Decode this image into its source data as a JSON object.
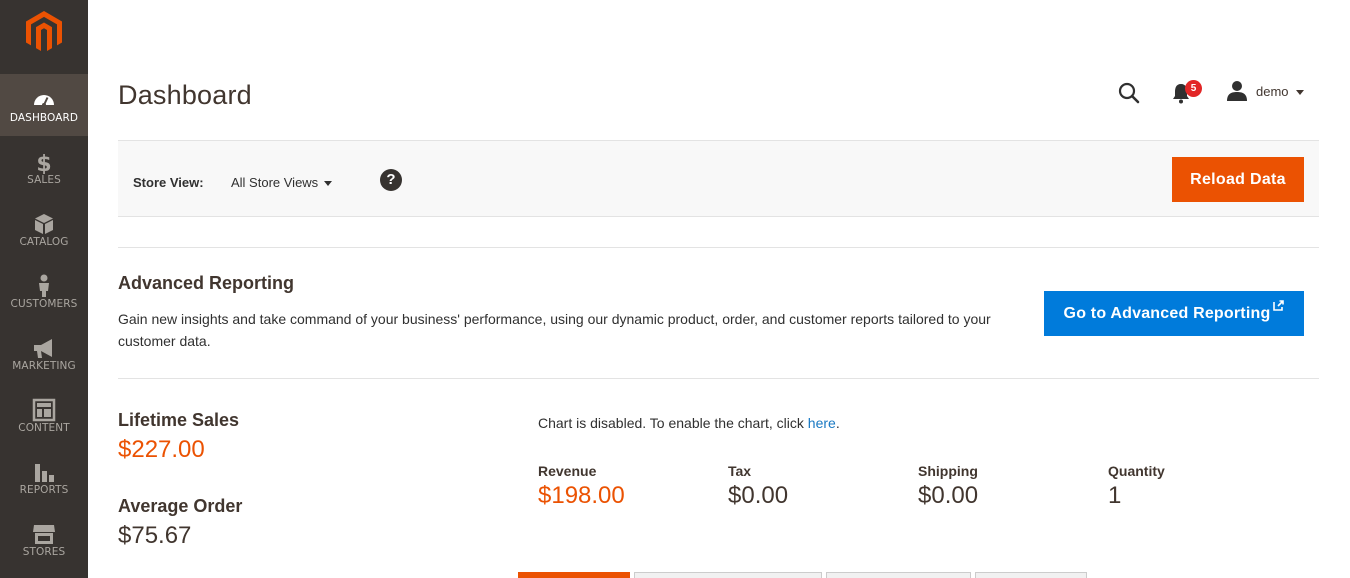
{
  "sidebar": {
    "items": [
      {
        "label": "DASHBOARD",
        "icon": "dashboard-icon"
      },
      {
        "label": "SALES",
        "icon": "dollar-icon"
      },
      {
        "label": "CATALOG",
        "icon": "box-icon"
      },
      {
        "label": "CUSTOMERS",
        "icon": "person-icon"
      },
      {
        "label": "MARKETING",
        "icon": "megaphone-icon"
      },
      {
        "label": "CONTENT",
        "icon": "layout-icon"
      },
      {
        "label": "REPORTS",
        "icon": "bar-chart-icon"
      },
      {
        "label": "STORES",
        "icon": "storefront-icon"
      }
    ]
  },
  "header": {
    "title": "Dashboard",
    "notification_count": "5",
    "user_name": "demo"
  },
  "store_bar": {
    "label": "Store View:",
    "selected": "All Store Views",
    "help": "?",
    "reload_label": "Reload Data"
  },
  "advanced": {
    "title": "Advanced Reporting",
    "description": "Gain new insights and take command of your business' performance, using our dynamic product, order, and customer reports tailored to your customer data.",
    "button_label": "Go to Advanced Reporting"
  },
  "stats": {
    "lifetime_label": "Lifetime Sales",
    "lifetime_value": "$227.00",
    "average_label": "Average Order",
    "average_value": "$75.67"
  },
  "chart_notice": {
    "text": "Chart is disabled. To enable the chart, click ",
    "link": "here",
    "suffix": "."
  },
  "totals": [
    {
      "label": "Revenue",
      "value": "$198.00"
    },
    {
      "label": "Tax",
      "value": "$0.00"
    },
    {
      "label": "Shipping",
      "value": "$0.00"
    },
    {
      "label": "Quantity",
      "value": "1"
    }
  ],
  "colors": {
    "accent": "#eb5202",
    "link_blue": "#007bdb",
    "sidebar": "#373330"
  }
}
